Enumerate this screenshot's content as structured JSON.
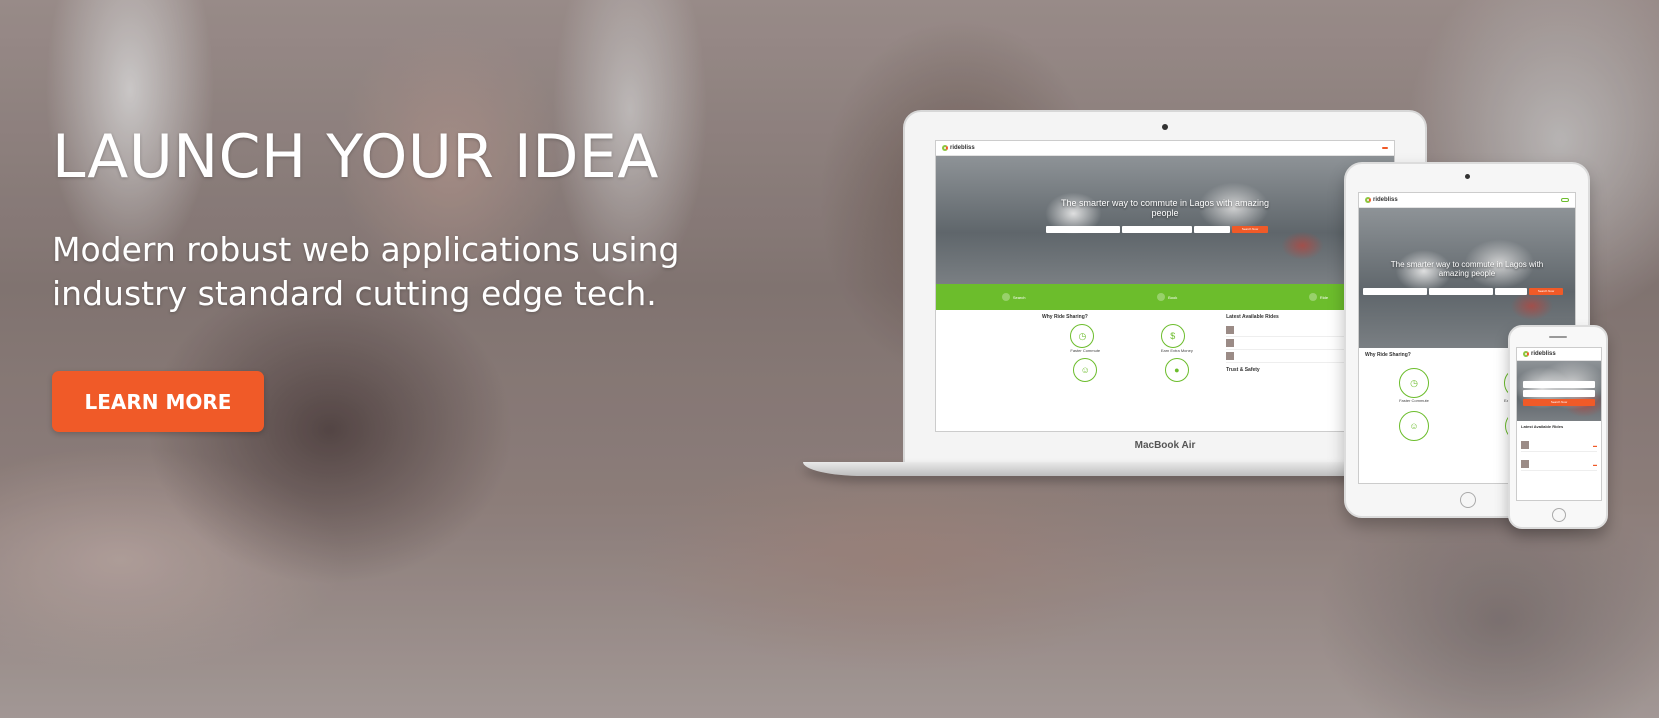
{
  "hero": {
    "headline": "LAUNCH YOUR IDEA",
    "subheadline": "Modern robust web applications using industry standard cutting edge tech.",
    "cta_label": "LEARN MORE"
  },
  "devices": {
    "laptop_label": "MacBook Air",
    "site": {
      "logo": "ridebliss",
      "tagline": "The smarter way to commute in Lagos with amazing people",
      "search_button": "Search Now",
      "steps": [
        "Search",
        "Book",
        "Ride"
      ],
      "why_title": "Why Ride Sharing?",
      "features": [
        "Faster Commute",
        "Earn Extra Money"
      ],
      "latest_rides_title": "Latest Available Rides",
      "trust_title": "Trust & Safety"
    }
  },
  "colors": {
    "accent": "#f05a28",
    "green": "#6cbd2c"
  }
}
